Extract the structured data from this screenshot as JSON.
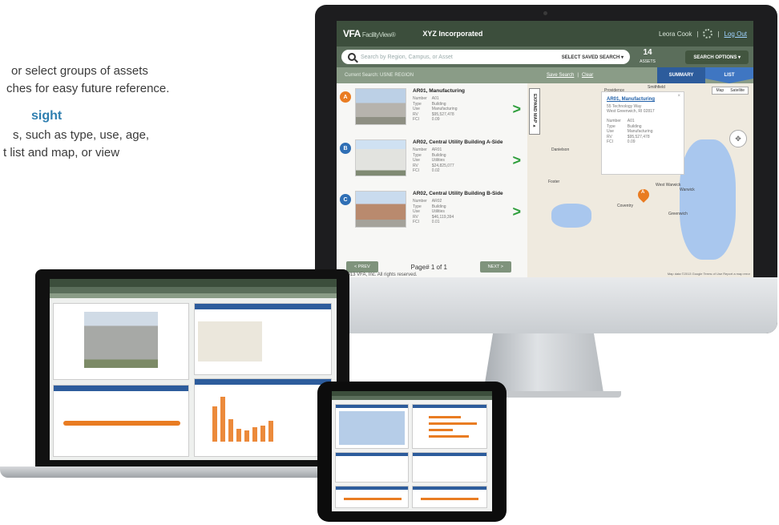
{
  "copy": {
    "line1": "or select groups of assets",
    "line2": "ches for easy future reference.",
    "heading": "sight",
    "line3": "s, such as type, use, age,",
    "line4": "t list and map, or view"
  },
  "app": {
    "logo": "VFA",
    "logo_sub": "FacilityView®",
    "company": "XYZ Incorporated",
    "user": "Leora Cook",
    "separator": "|",
    "logout": "Log Out",
    "search_placeholder": "Search by Region, Campus, or Asset",
    "saved_search": "SELECT SAVED SEARCH  ▾",
    "asset_count": "14",
    "asset_count_label": "ASSETS",
    "search_options": "SEARCH OPTIONS ▾",
    "current_search": "Current Search: USNE REGION",
    "save_search": "Save Search",
    "clear": "Clear",
    "tab_summary": "SUMMARY",
    "tab_list": "LIST",
    "expand_map": "EXPAND MAP ▸",
    "prev": "< PREV",
    "next": "NEXT >",
    "page": "Page# 1 of 1",
    "copyright": "© 2013 VFA, Inc. All rights reserved."
  },
  "assets": [
    {
      "marker": "A",
      "title": "AR01, Manufacturing",
      "fields": [
        [
          "Number",
          "A01"
        ],
        [
          "Type",
          "Building"
        ],
        [
          "Use",
          "Manufacturing"
        ],
        [
          "RV",
          "$95,527,478"
        ],
        [
          "FCI",
          "0.09"
        ]
      ]
    },
    {
      "marker": "B",
      "title": "AR02, Central Utility Building A-Side",
      "fields": [
        [
          "Number",
          "AR01"
        ],
        [
          "Type",
          "Building"
        ],
        [
          "Use",
          "Utilities"
        ],
        [
          "RV",
          "$24,825,077"
        ],
        [
          "FCI",
          "0.02"
        ]
      ]
    },
    {
      "marker": "C",
      "title": "AR02, Central Utility Building B-Side",
      "fields": [
        [
          "Number",
          "AR02"
        ],
        [
          "Type",
          "Building"
        ],
        [
          "Use",
          "Utilities"
        ],
        [
          "RV",
          "$46,119,394"
        ],
        [
          "FCI",
          "0.01"
        ]
      ]
    }
  ],
  "map": {
    "map_type": [
      "Map",
      "Satellite"
    ],
    "popup_title": "AR01, Manufacturing",
    "popup_address1": "55 Technology Way",
    "popup_address2": "West Greenwich, RI 02817",
    "popup_fields": [
      [
        "Number",
        "A01"
      ],
      [
        "Type",
        "Building"
      ],
      [
        "Use",
        "Manufacturing"
      ],
      [
        "RV",
        "$95,527,478"
      ],
      [
        "FCI",
        "0.09"
      ]
    ],
    "pin_label": "A",
    "towns": [
      "Warwick",
      "West Warwick",
      "Coventry",
      "Danielson",
      "Foster",
      "Smithfield",
      "Providence",
      "Greenwich"
    ],
    "credit": "Map data ©2013 Google   Terms of Use   Report a map error"
  },
  "icons": {
    "search": "search-icon",
    "gear": "gear-icon",
    "chevron": "chevron-right-icon",
    "pan": "pan-control-icon"
  },
  "colors": {
    "header": "#3c4e3c",
    "accent_orange": "#e97c22",
    "accent_blue": "#2d5c9c",
    "chevron_green": "#2e9e3b"
  }
}
